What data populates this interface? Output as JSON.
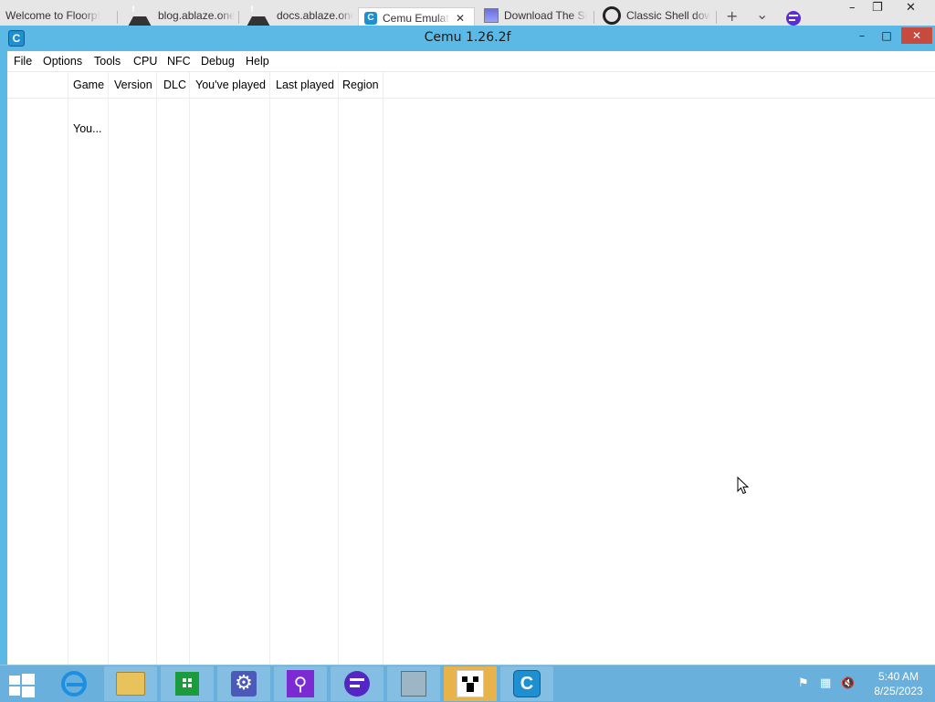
{
  "browser": {
    "tabs": [
      {
        "label": "Welcome to Floorp!",
        "icon": "none"
      },
      {
        "label": "blog.ablaze.one/",
        "icon": "warning-icon"
      },
      {
        "label": "docs.ablaze.one/",
        "icon": "warning-icon"
      },
      {
        "label": "Cemu Emulat",
        "icon": "cemu-icon",
        "active": true
      },
      {
        "label": "Download The Si",
        "icon": "download-site-icon"
      },
      {
        "label": "Classic Shell dow",
        "icon": "github-icon"
      }
    ],
    "new_tab_glyph": "+",
    "list_tabs_glyph": "⌄",
    "close_tab_glyph": "✕",
    "window_controls": {
      "minimize": "–",
      "restore": "❐",
      "close": "✕"
    }
  },
  "cemu": {
    "title": "Cemu 1.26.2f",
    "app_icon_letter": "C",
    "controls": {
      "minimize": "–",
      "maximize": "□",
      "close": "✕"
    },
    "menu": [
      "File",
      "Options",
      "Tools",
      "CPU",
      "NFC",
      "Debug",
      "Help"
    ],
    "columns": [
      "Game",
      "Version",
      "DLC",
      "You've played",
      "Last played",
      "Region"
    ],
    "rows": [
      {
        "game": "You..."
      }
    ]
  },
  "taskbar": {
    "apps": [
      {
        "name": "internet-explorer-icon"
      },
      {
        "name": "file-explorer-icon"
      },
      {
        "name": "store-icon"
      },
      {
        "name": "settings-gear-icon"
      },
      {
        "name": "search-icon"
      },
      {
        "name": "floorp-browser-icon"
      },
      {
        "name": "network-computer-icon"
      },
      {
        "name": "minecraft-creeper-icon"
      },
      {
        "name": "cemu-icon"
      }
    ],
    "tray": {
      "flag_glyph": "⚑",
      "network_glyph": "▦",
      "volume_glyph": "🔇"
    },
    "clock": {
      "time": "5:40 AM",
      "date": "8/25/2023"
    }
  }
}
